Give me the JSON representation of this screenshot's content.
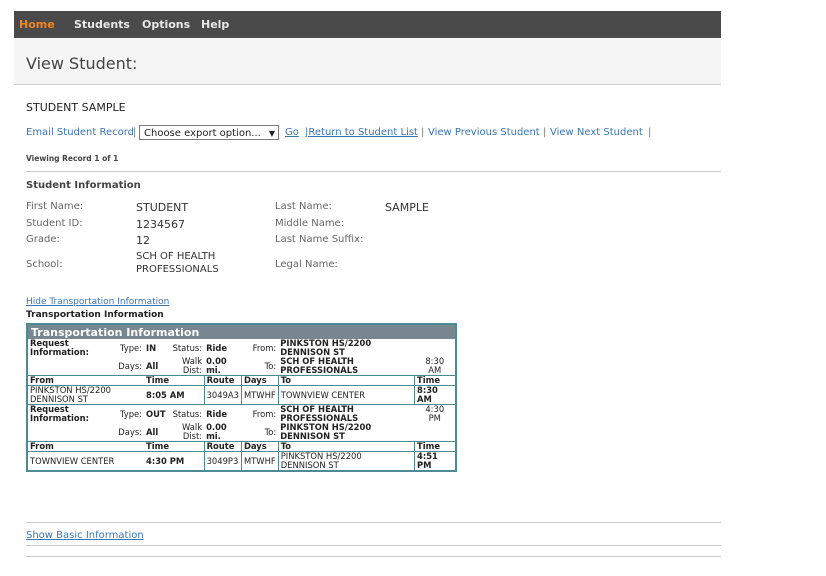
{
  "nav": {
    "home": "Home",
    "students": "Students",
    "options": "Options",
    "help": "Help"
  },
  "page_title": "View Student:",
  "student_name": "STUDENT SAMPLE",
  "actions": {
    "email": "Email Student Record",
    "sep": "|",
    "export_selected": "Choose export option...",
    "go": "Go",
    "return": "|Return to Student List",
    "previous": "View Previous Student",
    "next": "View Next Student"
  },
  "viewing": "Viewing Record 1 of 1",
  "info_heading": "Student Information",
  "fields": {
    "first_name_label": "First Name:",
    "first_name": "STUDENT",
    "student_id_label": "Student ID:",
    "student_id": "1234567",
    "grade_label": "Grade:",
    "grade": "12",
    "school_label": "School:",
    "school_line1": "SCH OF HEALTH",
    "school_line2": "PROFESSIONALS",
    "last_name_label": "Last Name:",
    "last_name": "SAMPLE",
    "middle_name_label": "Middle Name:",
    "suffix_label": "Last Name Suffix:",
    "legal_name_label": "Legal Name:"
  },
  "hide_transport": "Hide Transportation Information",
  "transport_heading": "Transportation Information",
  "transport": {
    "title": "Transportation Information",
    "req_label_1": "Request",
    "req_label_2": "Information:",
    "type_label": "Type:",
    "status_label": "Status:",
    "from_label": "From:",
    "days_label": "Days:",
    "walk_label_1": "Walk",
    "walk_label_2": "Dist:",
    "to_label": "To:",
    "col_from": "From",
    "col_time": "Time",
    "col_route": "Route",
    "col_days": "Days",
    "col_to": "To",
    "col_time2": "Time",
    "req1": {
      "type": "IN",
      "status": "Ride",
      "from_1": "PINKSTON HS/2200",
      "from_2": "DENNISON ST",
      "days": "All",
      "walk_1": "0.00",
      "walk_2": "mi.",
      "to_1": "SCH OF HEALTH",
      "to_2": "PROFESSIONALS",
      "time_1": "8:30",
      "time_2": "AM",
      "row": {
        "from_1": "PINKSTON HS/2200",
        "from_2": "DENNISON ST",
        "time": "8:05 AM",
        "route": "3049A3",
        "days": "MTWHF",
        "to": "TOWNVIEW CENTER",
        "time2": "8:30 AM"
      }
    },
    "req2": {
      "type": "OUT",
      "status": "Ride",
      "from_1": "SCH OF HEALTH",
      "from_2": "PROFESSIONALS",
      "time_1": "4:30",
      "time_2": "PM",
      "days": "All",
      "walk_1": "0.00",
      "walk_2": "mi.",
      "to_1": "PINKSTON HS/2200",
      "to_2": "DENNISON ST",
      "row": {
        "from": "TOWNVIEW CENTER",
        "time": "4:30 PM",
        "route": "3049P3",
        "days": "MTWHF",
        "to_1": "PINKSTON HS/2200",
        "to_2": "DENNISON ST",
        "time2": "4:51 PM"
      }
    }
  },
  "show_basic": "Show Basic Information"
}
